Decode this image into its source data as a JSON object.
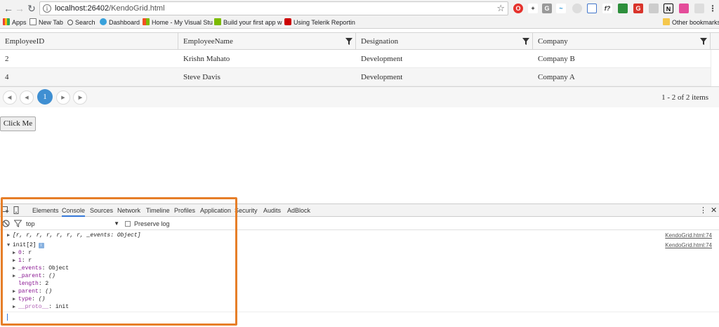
{
  "browser": {
    "url_host": "localhost:26402",
    "url_path": "/KendoGrid.html",
    "bookmarks": [
      {
        "label": "Apps",
        "color": "#4285f4"
      },
      {
        "label": "New Tab",
        "color": "#ffffff"
      },
      {
        "label": "Search",
        "color": "#ffffff"
      },
      {
        "label": "Dashboard",
        "color": "#38a1db"
      },
      {
        "label": "Home - My Visual Stu",
        "color": "#f25022"
      },
      {
        "label": "Build your first app w",
        "color": "#7cbb00"
      },
      {
        "label": "Using Telerik Reportin",
        "color": "#cc0000"
      }
    ],
    "other_bookmarks": "Other bookmarks"
  },
  "grid": {
    "columns": [
      "EmployeeID",
      "EmployeeName",
      "Designation",
      "Company"
    ],
    "rows": [
      [
        "2",
        "Krishn Mahato",
        "Development",
        "Company B"
      ],
      [
        "4",
        "Steve Davis",
        "Development",
        "Company A"
      ]
    ],
    "pager": {
      "current_page": "1",
      "info": "1 - 2 of 2 items"
    }
  },
  "page": {
    "button_label": "Click Me"
  },
  "devtools": {
    "tabs": [
      "Elements",
      "Console",
      "Sources",
      "Network",
      "Timeline",
      "Profiles",
      "Application",
      "Security",
      "Audits",
      "AdBlock"
    ],
    "active_tab": "Console",
    "context": "top",
    "preserve_log": "Preserve log",
    "lines": {
      "l1": "[r, r, r, r, r, r, r, _events: Object]",
      "l1_src": "KendoGrid.html:74",
      "l2": "init[2]",
      "l2_src": "KendoGrid.html:74",
      "p0k": "0",
      "p0v": "r",
      "p1k": "1",
      "p1v": "r",
      "p2k": "_events",
      "p2v": "Object",
      "p3k": "_parent",
      "p3v": "()",
      "p4k": "length",
      "p4v": "2",
      "p5k": "parent",
      "p5v": "()",
      "p6k": "type",
      "p6v": "()",
      "p7k": "__proto__",
      "p7v": "init"
    }
  },
  "colors": {
    "accent": "#3f8fd2",
    "highlight": "#e67e28",
    "devtools_active": "#3879d9"
  }
}
